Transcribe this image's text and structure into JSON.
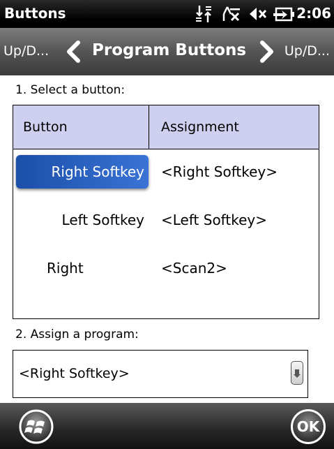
{
  "status_bar": {
    "title": "Buttons",
    "time": "2:06",
    "icons": [
      "data-connection-icon",
      "no-signal-icon",
      "volume-muted-icon",
      "battery-charging-icon"
    ]
  },
  "nav": {
    "prev_label": "Up/D...",
    "title": "Program Buttons",
    "next_label": "Up/D..."
  },
  "step1_label": "1. Select a button:",
  "table": {
    "headers": [
      "Button",
      "Assignment"
    ],
    "rows": [
      {
        "button": "Right Softkey",
        "assignment": "<Right Softkey>",
        "selected": true
      },
      {
        "button": "Left Softkey",
        "assignment": "<Left Softkey>",
        "selected": false
      },
      {
        "button": "Right",
        "assignment": "<Scan2>",
        "selected": false
      }
    ]
  },
  "step2_label": "2. Assign a program:",
  "program_select": {
    "value": "<Right Softkey>"
  },
  "bottom_bar": {
    "start_icon": "windows-start-icon",
    "ok_label": "OK"
  },
  "colors": {
    "header_bg": "#cfcfef",
    "selection": "#2a63c4"
  }
}
